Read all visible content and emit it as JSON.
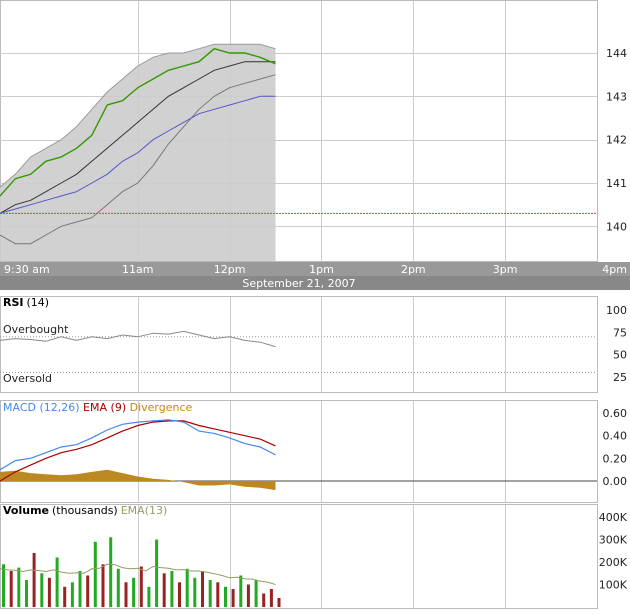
{
  "chart_data": [
    {
      "type": "line",
      "panel": "price",
      "date_label": "September 21, 2007",
      "x_tick_labels": [
        "9:30 am",
        "11am",
        "12pm",
        "1pm",
        "2pm",
        "3pm",
        "4pm"
      ],
      "x_tick_minutes": [
        0,
        90,
        150,
        210,
        270,
        330,
        390
      ],
      "x_range_minutes": [
        0,
        390
      ],
      "y_ticks": [
        140,
        141,
        142,
        143,
        144
      ],
      "y_tick_labels": [
        "140",
        "141",
        "142",
        "143",
        "144"
      ],
      "ylim": [
        139.2,
        145.2
      ],
      "previous_close": 140.3,
      "x_minutes": [
        0,
        10,
        20,
        30,
        40,
        50,
        60,
        70,
        80,
        90,
        100,
        110,
        120,
        130,
        140,
        150,
        160,
        170,
        180
      ],
      "series": [
        {
          "role": "price",
          "values": [
            140.7,
            141.1,
            141.2,
            141.5,
            141.6,
            141.8,
            142.1,
            142.8,
            142.9,
            143.2,
            143.4,
            143.6,
            143.7,
            143.8,
            144.1,
            144.0,
            144.0,
            143.9,
            143.75
          ]
        },
        {
          "role": "upper-band",
          "values": [
            140.9,
            141.2,
            141.6,
            141.8,
            142.0,
            142.3,
            142.7,
            143.1,
            143.4,
            143.7,
            143.9,
            144.0,
            144.0,
            144.1,
            144.2,
            144.2,
            144.2,
            144.2,
            144.1
          ]
        },
        {
          "role": "lower-band",
          "values": [
            139.8,
            139.6,
            139.6,
            139.8,
            140.0,
            140.1,
            140.2,
            140.5,
            140.8,
            141.0,
            141.4,
            141.9,
            142.3,
            142.7,
            143.0,
            143.2,
            143.3,
            143.4,
            143.5
          ]
        },
        {
          "role": "middle-band",
          "values": [
            140.3,
            140.5,
            140.6,
            140.8,
            141.0,
            141.2,
            141.5,
            141.8,
            142.1,
            142.4,
            142.7,
            143.0,
            143.2,
            143.4,
            143.6,
            143.7,
            143.8,
            143.8,
            143.8
          ]
        },
        {
          "role": "moving-average",
          "values": [
            140.3,
            140.4,
            140.5,
            140.6,
            140.7,
            140.8,
            141.0,
            141.2,
            141.5,
            141.7,
            142.0,
            142.2,
            142.4,
            142.6,
            142.7,
            142.8,
            142.9,
            143.0,
            143.0
          ]
        }
      ],
      "colors": {
        "price": "#339900",
        "upper-band": "#999999",
        "lower-band": "#777777",
        "middle-band": "#333333",
        "moving-average": "#5555cc",
        "band_fill": "#cccccc",
        "previous_close": "#cc4444"
      }
    },
    {
      "type": "line",
      "panel": "rsi",
      "title": "RSI",
      "title_param": "(14)",
      "ylim": [
        0,
        100
      ],
      "y_ticks": [
        25,
        50,
        75,
        100
      ],
      "y_tick_labels": [
        "25",
        "50",
        "75",
        "100"
      ],
      "levels": [
        {
          "label": "Overbought",
          "value": 70
        },
        {
          "label": "Oversold",
          "value": 30
        }
      ],
      "x_minutes": [
        0,
        10,
        20,
        30,
        40,
        50,
        60,
        70,
        80,
        90,
        100,
        110,
        120,
        130,
        140,
        150,
        160,
        170,
        180
      ],
      "values": [
        66,
        68,
        67,
        65,
        70,
        66,
        70,
        68,
        72,
        70,
        74,
        73,
        76,
        72,
        68,
        70,
        66,
        64,
        59
      ],
      "color": "#888888"
    },
    {
      "type": "line",
      "panel": "macd",
      "title_parts": [
        {
          "text": "MACD",
          "color": "#4488ee"
        },
        {
          "text": " (12,26)",
          "color": "#4488ee"
        },
        {
          "text": " EMA",
          "color": "#aa0000"
        },
        {
          "text": " (9)",
          "color": "#aa0000"
        },
        {
          "text": " Divergence",
          "color": "#cc8800"
        }
      ],
      "ylim": [
        -0.12,
        0.62
      ],
      "y_ticks": [
        0.0,
        0.2,
        0.4,
        0.6
      ],
      "y_tick_labels": [
        "0.00",
        "0.20",
        "0.40",
        "0.60"
      ],
      "x_minutes": [
        0,
        10,
        20,
        30,
        40,
        50,
        60,
        70,
        80,
        90,
        100,
        110,
        120,
        130,
        140,
        150,
        160,
        170,
        180
      ],
      "series": [
        {
          "name": "MACD",
          "values": [
            0.1,
            0.18,
            0.2,
            0.25,
            0.3,
            0.32,
            0.38,
            0.45,
            0.5,
            0.52,
            0.53,
            0.54,
            0.52,
            0.44,
            0.42,
            0.38,
            0.33,
            0.3,
            0.23
          ],
          "color": "#4488ee"
        },
        {
          "name": "EMA",
          "values": [
            0.0,
            0.08,
            0.14,
            0.2,
            0.25,
            0.28,
            0.32,
            0.38,
            0.44,
            0.49,
            0.52,
            0.53,
            0.53,
            0.49,
            0.46,
            0.43,
            0.4,
            0.37,
            0.31
          ],
          "color": "#aa0000"
        },
        {
          "name": "Divergence",
          "values": [
            0.08,
            0.09,
            0.07,
            0.06,
            0.05,
            0.06,
            0.08,
            0.1,
            0.07,
            0.04,
            0.02,
            0.01,
            -0.01,
            -0.04,
            -0.04,
            -0.03,
            -0.05,
            -0.06,
            -0.08
          ],
          "color": "#bb8822"
        }
      ]
    },
    {
      "type": "bar",
      "panel": "volume",
      "title": "Volume",
      "title_param": "(thousands)",
      "ema_label": "EMA(13)",
      "ylim": [
        0,
        420
      ],
      "y_ticks": [
        100,
        200,
        300,
        400
      ],
      "y_tick_labels": [
        "100K",
        "200K",
        "300K",
        "400K"
      ],
      "x_minutes": [
        0,
        5,
        10,
        15,
        20,
        25,
        30,
        35,
        40,
        45,
        50,
        55,
        60,
        65,
        70,
        75,
        80,
        85,
        90,
        95,
        100,
        105,
        110,
        115,
        120,
        125,
        130,
        135,
        140,
        145,
        150,
        155,
        160,
        165,
        170,
        175,
        180
      ],
      "values": [
        190,
        160,
        175,
        120,
        240,
        150,
        130,
        220,
        90,
        110,
        160,
        140,
        290,
        190,
        310,
        170,
        110,
        130,
        180,
        90,
        300,
        150,
        160,
        110,
        170,
        130,
        160,
        120,
        110,
        90,
        80,
        140,
        100,
        120,
        60,
        80,
        40
      ],
      "up": [
        true,
        false,
        true,
        true,
        false,
        true,
        false,
        true,
        false,
        true,
        true,
        false,
        true,
        false,
        true,
        true,
        false,
        true,
        false,
        true,
        true,
        false,
        true,
        false,
        true,
        true,
        false,
        true,
        false,
        true,
        false,
        true,
        false,
        true,
        false,
        false,
        false
      ],
      "ema_values": [
        170,
        165,
        163,
        158,
        165,
        162,
        158,
        165,
        155,
        150,
        152,
        150,
        170,
        172,
        190,
        188,
        175,
        170,
        172,
        160,
        180,
        175,
        172,
        165,
        166,
        160,
        160,
        155,
        148,
        140,
        130,
        132,
        125,
        124,
        115,
        110,
        100
      ],
      "colors": {
        "up": "#22aa22",
        "down": "#992222",
        "ema": "#999966"
      }
    }
  ]
}
